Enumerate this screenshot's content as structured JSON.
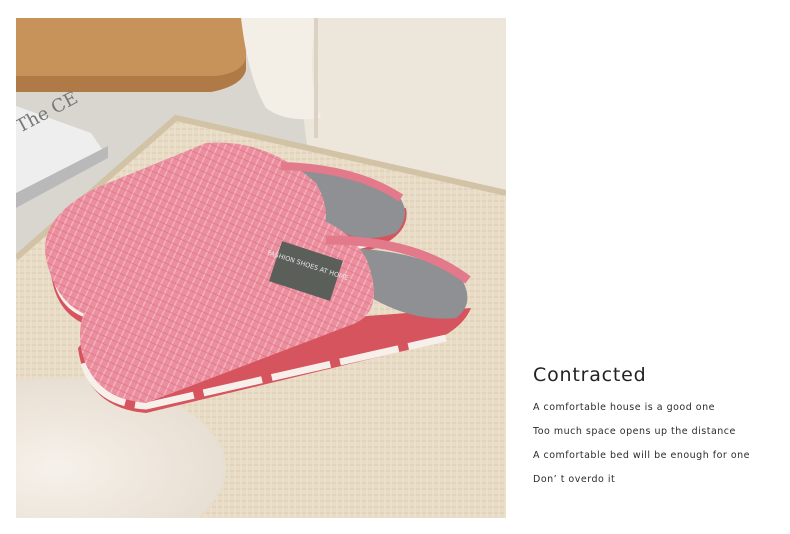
{
  "product_photo": {
    "tag_label": "FASHION SHOES AT HOME",
    "book_cover_text": "The CE"
  },
  "copy": {
    "title": "Contracted",
    "lines": [
      "A comfortable house is a  good one",
      "Too much space opens up the distance",
      "A comfortable bed will be enough for one",
      "Don’ t overdo it"
    ]
  },
  "colors": {
    "slipper_pink": "#e98a9a",
    "sole_red": "#d6545e",
    "lining_gray": "#8e9094",
    "rug_beige": "#e8dcc6",
    "text_dark": "#222222"
  }
}
